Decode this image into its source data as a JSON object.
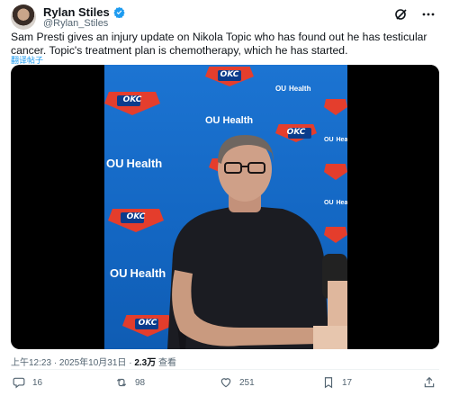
{
  "author": {
    "name": "Rylan Stiles",
    "handle": "@Rylan_Stiles",
    "verified_color": "#1d9bf0"
  },
  "header_icons": [
    "grok-icon",
    "more-icon"
  ],
  "tweet": {
    "text": "Sam Presti gives an injury update on Nikola Topic who has found out he has testicular cancer. Topic's treatment plan is chemotherapy, which he has started.",
    "translate_label": "翻译帖子"
  },
  "media": {
    "backdrop_brand": "OKC",
    "backdrop_sponsor": "Health"
  },
  "meta": {
    "time": "上午12:23",
    "date": "2025年10月31日",
    "views": "2.3万",
    "views_label": "查看"
  },
  "actions": {
    "replies": "16",
    "reposts": "98",
    "likes": "251",
    "bookmarks": "17"
  },
  "colors": {
    "accent": "#1d9bf0",
    "text": "#0f1419",
    "muted": "#536471",
    "backdrop_blue": "#1366c2",
    "okc_orange": "#ef3b24"
  }
}
